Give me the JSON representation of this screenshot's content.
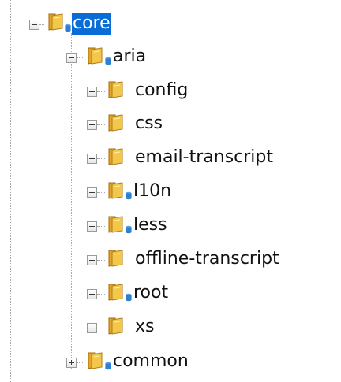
{
  "tree": {
    "root": {
      "label": "core",
      "expanded": true,
      "selected": true,
      "badge": "db-badge-icon"
    },
    "aria": {
      "label": "aria",
      "expanded": true,
      "badge": "db-badge-icon"
    },
    "children": [
      {
        "label": "config",
        "expanded": false,
        "badge": null
      },
      {
        "label": "css",
        "expanded": false,
        "badge": null
      },
      {
        "label": "email-transcript",
        "expanded": false,
        "badge": null
      },
      {
        "label": "l10n",
        "expanded": false,
        "badge": "db-badge-icon"
      },
      {
        "label": "less",
        "expanded": false,
        "badge": "db-badge-icon"
      },
      {
        "label": "offline-transcript",
        "expanded": false,
        "badge": null
      },
      {
        "label": "root",
        "expanded": false,
        "badge": "db-badge-icon"
      },
      {
        "label": "xs",
        "expanded": false,
        "badge": null
      }
    ],
    "common": {
      "label": "common",
      "expanded": false,
      "badge": "db-badge-icon"
    }
  },
  "colors": {
    "selection": "#0a6cd6",
    "folder": "#f3c84a",
    "badge": "#2f7fd0",
    "guide": "#a8a8a8"
  },
  "icons": {
    "folder": "folder-icon",
    "expanded": "collapse-icon",
    "collapsed": "expand-icon"
  }
}
